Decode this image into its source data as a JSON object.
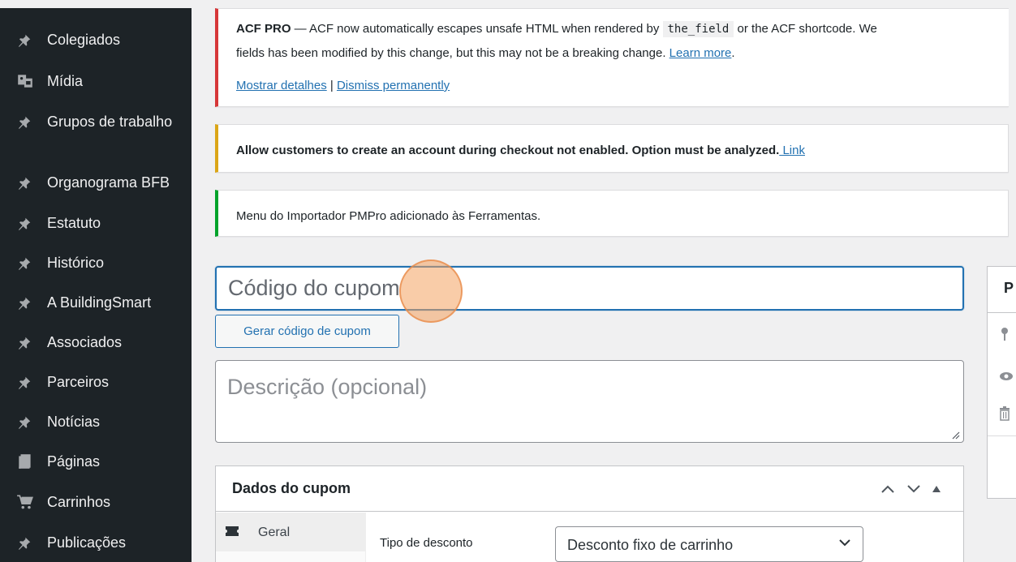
{
  "sidebar": {
    "items": [
      {
        "label": "Colegiados",
        "icon": "pin-icon"
      },
      {
        "label": "Mídia",
        "icon": "media-icon"
      },
      {
        "label": "Grupos de trabalho",
        "icon": "pin-icon"
      },
      {
        "label": "Organograma BFB",
        "icon": "pin-icon"
      },
      {
        "label": "Estatuto",
        "icon": "pin-icon"
      },
      {
        "label": "Histórico",
        "icon": "pin-icon"
      },
      {
        "label": "A BuildingSmart",
        "icon": "pin-icon"
      },
      {
        "label": "Associados",
        "icon": "pin-icon"
      },
      {
        "label": "Parceiros",
        "icon": "pin-icon"
      },
      {
        "label": "Notícias",
        "icon": "pin-icon"
      },
      {
        "label": "Páginas",
        "icon": "pages-icon"
      },
      {
        "label": "Carrinhos",
        "icon": "cart-icon"
      },
      {
        "label": "Publicações",
        "icon": "pin-icon"
      }
    ]
  },
  "notices": {
    "acf": {
      "prefix": "ACF PRO",
      "text1": " — ACF now automatically escapes unsafe HTML when rendered by ",
      "code": "the_field",
      "text2": " or the ACF shortcode. We",
      "text3": "fields has been modified by this change, but this may not be a breaking change. ",
      "learn_more": "Learn more",
      "show_details": "Mostrar detalhes",
      "separator": " | ",
      "dismiss": "Dismiss permanently"
    },
    "warning": {
      "text": "Allow customers to create an account during checkout not enabled. Option must be analyzed.",
      "link": " Link"
    },
    "success": {
      "text": "Menu do Importador PMPro adicionado às Ferramentas."
    }
  },
  "coupon": {
    "code_placeholder": "Código do cupom",
    "generate_button": "Gerar código de cupom",
    "description_placeholder": "Descrição (opcional)"
  },
  "coupon_data": {
    "title": "Dados do cupom",
    "tab_general": "Geral",
    "discount_type_label": "Tipo de desconto",
    "discount_type_value": "Desconto fixo de carrinho"
  },
  "publish_box": {
    "title_initial": "P"
  },
  "colors": {
    "sidebar_bg": "#1d2327",
    "accent": "#2271b1",
    "error": "#d63638",
    "warning": "#dba617",
    "success": "#00a32a"
  }
}
